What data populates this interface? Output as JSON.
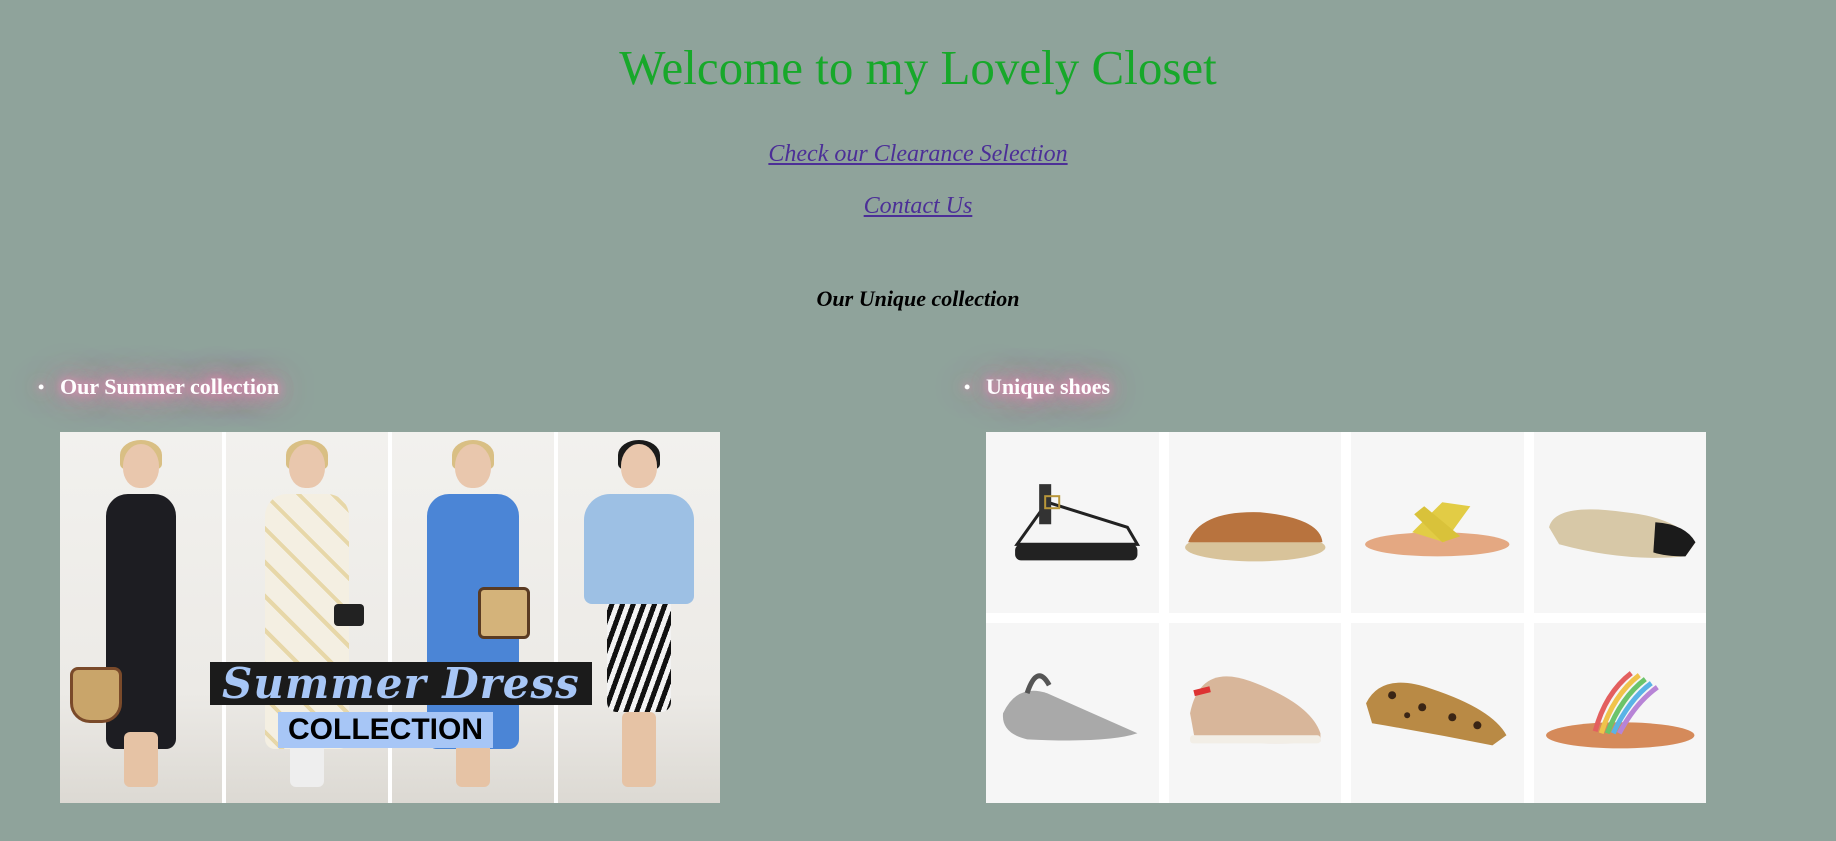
{
  "header": {
    "title": "Welcome to my Lovely Closet"
  },
  "nav": {
    "clearance_link": "Check our Clearance Selection",
    "contact_link": "Contact Us"
  },
  "collection": {
    "heading": "Our Unique collection",
    "sections": [
      {
        "label": "Our Summer collection"
      },
      {
        "label": "Unique shoes"
      }
    ]
  },
  "summer_image": {
    "overlay_line1": "Summer Dress",
    "overlay_line2": "COLLECTION",
    "accent": "#a7c6f6"
  },
  "colors": {
    "background": "#8fa39b",
    "title": "#17a82a",
    "link": "#4c2f97",
    "glow": "#e58bb4"
  },
  "shoes": [
    {
      "name": "black-white-sandal-icon"
    },
    {
      "name": "tan-espadrille-icon"
    },
    {
      "name": "yellow-slide-icon"
    },
    {
      "name": "quilted-flat-icon"
    },
    {
      "name": "silver-mule-icon"
    },
    {
      "name": "beige-oxford-icon"
    },
    {
      "name": "leopard-loafer-icon"
    },
    {
      "name": "rainbow-thong-sandal-icon"
    }
  ]
}
